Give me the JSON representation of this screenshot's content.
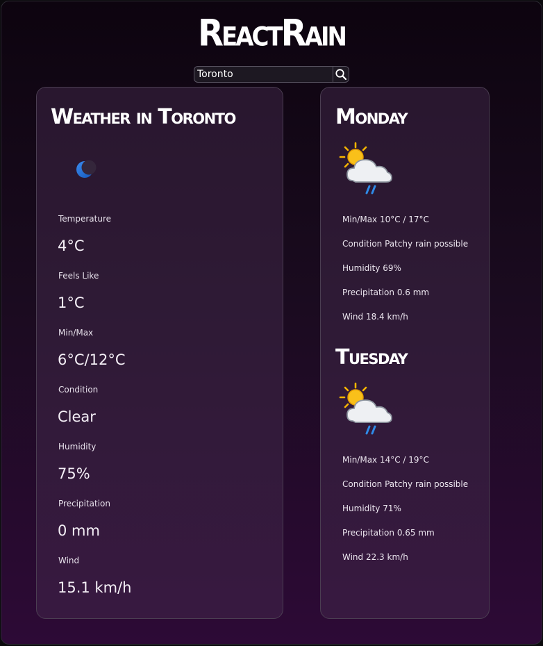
{
  "app": {
    "title": "ReactRain",
    "search": {
      "value": "Toronto",
      "icon": "search-icon"
    }
  },
  "current": {
    "heading": "Weather in Toronto",
    "icon": "moon-icon",
    "stats": [
      {
        "label": "Temperature",
        "value": "4°C"
      },
      {
        "label": "Feels Like",
        "value": "1°C"
      },
      {
        "label": "Min/Max",
        "value": "6°C/12°C"
      },
      {
        "label": "Condition",
        "value": "Clear"
      },
      {
        "label": "Humidity",
        "value": "75%"
      },
      {
        "label": "Precipitation",
        "value": "0 mm"
      },
      {
        "label": "Wind",
        "value": "15.1 km/h"
      }
    ]
  },
  "forecast": [
    {
      "day": "Monday",
      "icon": "sun-cloud-rain-icon",
      "minmax": "Min/Max 10°C / 17°C",
      "condition": "Condition Patchy rain possible",
      "humidity": "Humidity 69%",
      "precipitation": "Precipitation 0.6 mm",
      "wind": "Wind 18.4 km/h"
    },
    {
      "day": "Tuesday",
      "icon": "sun-cloud-rain-icon",
      "minmax": "Min/Max 14°C / 19°C",
      "condition": "Condition Patchy rain possible",
      "humidity": "Humidity 71%",
      "precipitation": "Precipitation 0.65 mm",
      "wind": "Wind 22.3 km/h"
    }
  ],
  "colors": {
    "background_top": "#0d040f",
    "background_bottom": "#2d0a36",
    "moon": "#1e6fd6",
    "sun": "#f7b500",
    "rain": "#2f8be8"
  }
}
